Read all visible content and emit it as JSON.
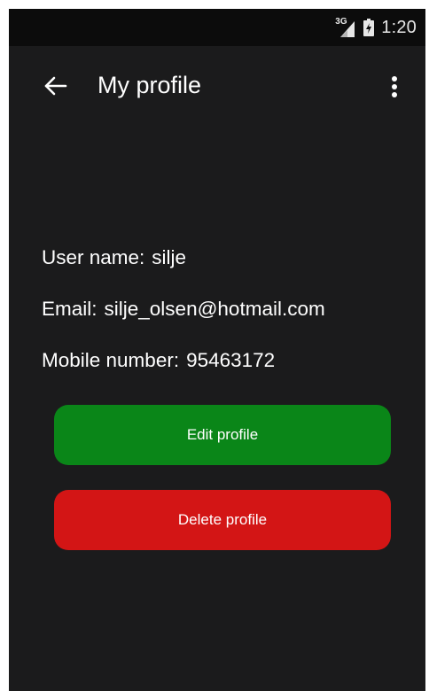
{
  "status_bar": {
    "network_label": "3G",
    "time": "1:20",
    "icons": [
      "signal-icon",
      "battery-icon"
    ]
  },
  "app_bar": {
    "title": "My profile",
    "icons": [
      "back-arrow-icon",
      "more-vert-icon"
    ]
  },
  "profile": {
    "username_label": "User name:",
    "username_value": "silje",
    "email_label": "Email:",
    "email_value": "silje_olsen@hotmail.com",
    "mobile_label": "Mobile number:",
    "mobile_value": "95463172"
  },
  "actions": {
    "edit_label": "Edit profile",
    "delete_label": "Delete profile"
  },
  "colors": {
    "background": "#1b1b1c",
    "status_bar": "#0c0c0c",
    "edit_button": "#0a8618",
    "delete_button": "#d31515",
    "text": "#ffffff"
  }
}
